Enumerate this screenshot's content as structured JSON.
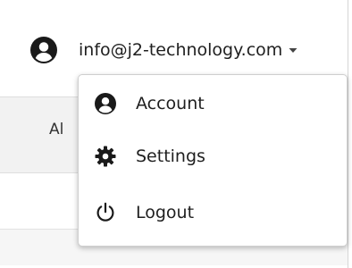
{
  "header": {
    "email": "info@j2-technology.com",
    "avatar_icon": "user-circle-icon",
    "caret_icon": "caret-down-icon"
  },
  "background": {
    "partial_label": "Al"
  },
  "dropdown": {
    "items": [
      {
        "label": "Account",
        "icon": "user-circle-icon"
      },
      {
        "label": "Settings",
        "icon": "gear-icon"
      },
      {
        "label": "Logout",
        "icon": "power-icon"
      }
    ]
  },
  "colors": {
    "text": "#1f1f1f",
    "icon": "#1a1a1a",
    "band": "#f2f2f2",
    "border": "#cfcfcf"
  }
}
